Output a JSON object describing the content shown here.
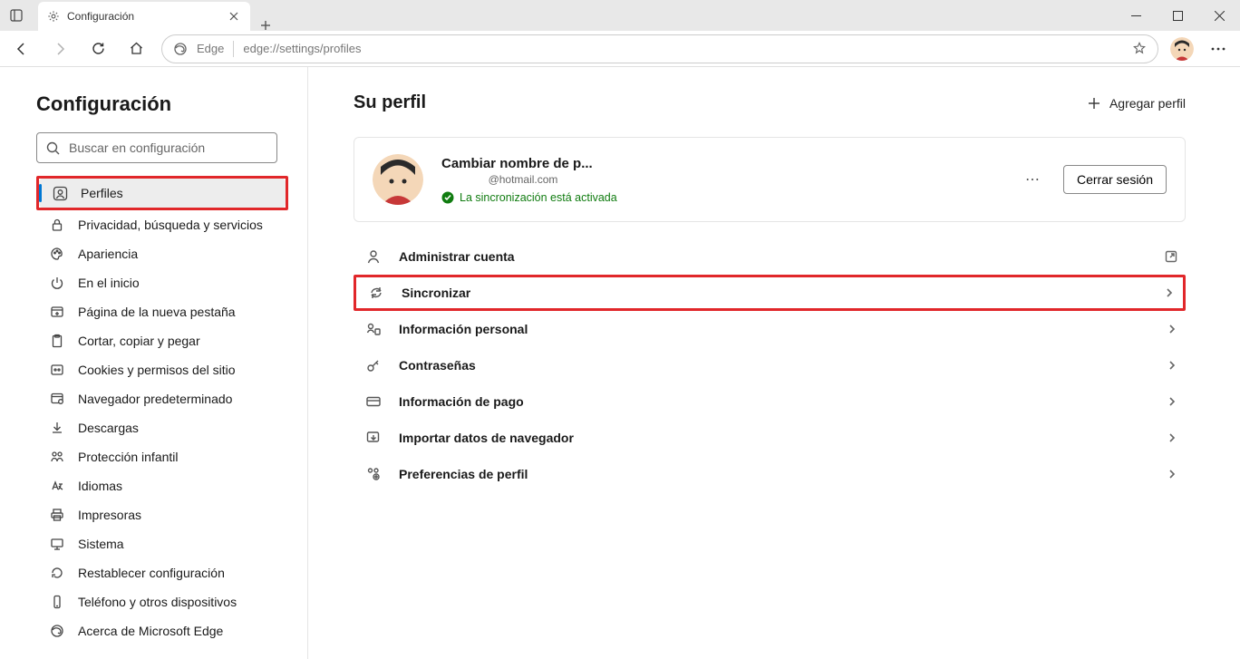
{
  "tab": {
    "title": "Configuración"
  },
  "address": {
    "edge_label": "Edge",
    "url": "edge://settings/profiles"
  },
  "sidebar": {
    "title": "Configuración",
    "search_placeholder": "Buscar en configuración",
    "items": [
      {
        "label": "Perfiles"
      },
      {
        "label": "Privacidad, búsqueda y servicios"
      },
      {
        "label": "Apariencia"
      },
      {
        "label": "En el inicio"
      },
      {
        "label": "Página de la nueva pestaña"
      },
      {
        "label": "Cortar, copiar y pegar"
      },
      {
        "label": "Cookies y permisos del sitio"
      },
      {
        "label": "Navegador predeterminado"
      },
      {
        "label": "Descargas"
      },
      {
        "label": "Protección infantil"
      },
      {
        "label": "Idiomas"
      },
      {
        "label": "Impresoras"
      },
      {
        "label": "Sistema"
      },
      {
        "label": "Restablecer configuración"
      },
      {
        "label": "Teléfono y otros dispositivos"
      },
      {
        "label": "Acerca de Microsoft Edge"
      }
    ]
  },
  "main": {
    "header": "Su perfil",
    "add_profile": "Agregar perfil",
    "profile": {
      "name": "Cambiar nombre de p...",
      "email": "@hotmail.com",
      "sync_status": "La sincronización está activada",
      "signout": "Cerrar sesión"
    },
    "rows": [
      {
        "label": "Administrar cuenta"
      },
      {
        "label": "Sincronizar"
      },
      {
        "label": "Información personal"
      },
      {
        "label": "Contraseñas"
      },
      {
        "label": "Información de pago"
      },
      {
        "label": "Importar datos de navegador"
      },
      {
        "label": "Preferencias de perfil"
      }
    ]
  }
}
